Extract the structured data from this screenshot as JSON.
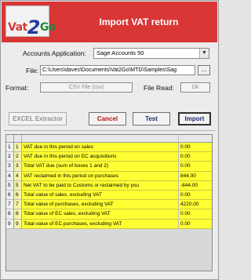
{
  "window": {
    "title": "Import VAT return",
    "logo": {
      "left": "Vat",
      "middle": "2",
      "right": "Go"
    }
  },
  "form": {
    "accounts_application_label": "Accounts Application:",
    "accounts_application_value": "Sage Accounts 50",
    "file_label": "File:",
    "file_value": "C:\\Users\\daves\\Documents\\Vat2Go\\MTD\\Samples\\Sag",
    "browse_label": "...",
    "format_label": "Format:",
    "format_value": "CSV File (csv)",
    "file_read_label": "File Read:",
    "file_read_value": "Ok"
  },
  "buttons": {
    "excel_extractor": "EXCEL Extractor",
    "cancel": "Cancel",
    "test": "Test",
    "import": "Import"
  },
  "table": {
    "rows": [
      {
        "index": "1",
        "box": "1",
        "description": "VAT due in this period on sales",
        "value": "0.00"
      },
      {
        "index": "2",
        "box": "2",
        "description": "VAT due in this period on EC acquisitions",
        "value": "0.00"
      },
      {
        "index": "3",
        "box": "3",
        "description": "Total VAT due (sum of boxes 1 and 2)",
        "value": "0.00"
      },
      {
        "index": "4",
        "box": "4",
        "description": "VAT reclaimed in this period on purchases",
        "value": "844.00"
      },
      {
        "index": "5",
        "box": "5",
        "description": "Net VAT to be paid to Customs or reclaimed by you",
        "value": "-844.00"
      },
      {
        "index": "6",
        "box": "6",
        "description": "Total value of sales, excluding VAT",
        "value": "0.00"
      },
      {
        "index": "7",
        "box": "7",
        "description": "Total value of purchases, excluding VAT",
        "value": "4220.00"
      },
      {
        "index": "8",
        "box": "8",
        "description": "Total value of EC sales, excluding VAT",
        "value": "0.00"
      },
      {
        "index": "9",
        "box": "9",
        "description": "Total value of EC purchases, excluding VAT",
        "value": "0.00"
      }
    ]
  },
  "colors": {
    "titlebar": "#d93636",
    "grid_highlight": "#ffff33"
  }
}
